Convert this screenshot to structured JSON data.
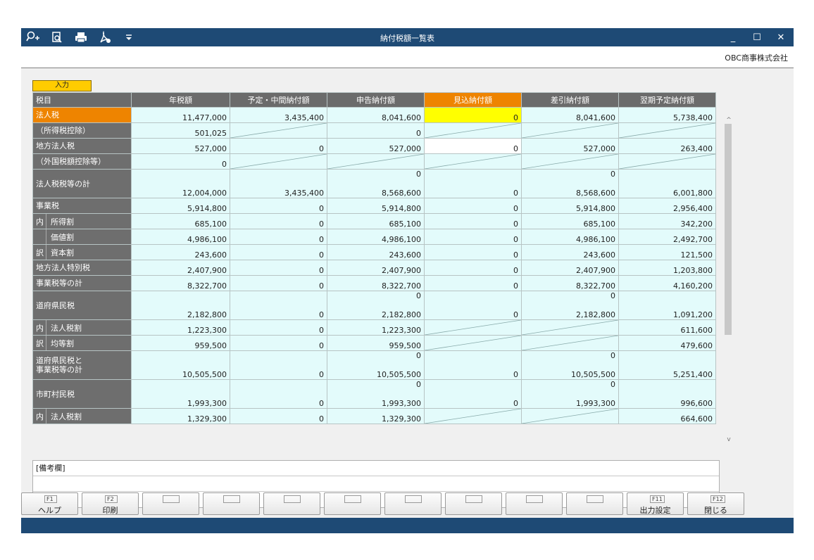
{
  "window": {
    "title": "納付税額一覧表",
    "company": "OBC商事株式会社"
  },
  "toolbar": {
    "icons": [
      "zoom-in-icon",
      "preview-icon",
      "print-icon",
      "pdf-icon",
      "dropdown-icon"
    ]
  },
  "tab": {
    "label": "入力"
  },
  "columns": [
    "税目",
    "年税額",
    "予定・中間納付額",
    "申告納付額",
    "見込納付額",
    "差引納付額",
    "翌期予定納付額"
  ],
  "rows": [
    {
      "label": "法人税",
      "type": "normal",
      "cells": [
        "11,477,000",
        "3,435,400",
        "8,041,600",
        "0",
        "8,041,600",
        "5,738,400"
      ]
    },
    {
      "label": "（所得税控除）",
      "type": "normal",
      "cells": [
        "501,025",
        "",
        "0",
        "",
        "",
        ""
      ]
    },
    {
      "label": "地方法人税",
      "type": "normal",
      "cells": [
        "527,000",
        "0",
        "527,000",
        "0",
        "527,000",
        "263,400"
      ]
    },
    {
      "label": "（外国税額控除等）",
      "type": "normal",
      "cells": [
        "0",
        "",
        "",
        "",
        "",
        ""
      ]
    },
    {
      "label": "法人税税等の計",
      "type": "tall",
      "cells": [
        "12,004,000",
        "3,435,400",
        "8,568,600",
        "0",
        "8,568,600",
        "6,001,800"
      ],
      "tops": [
        "",
        "",
        "0",
        "",
        "0",
        ""
      ]
    },
    {
      "label": "事業税",
      "type": "normal",
      "cells": [
        "5,914,800",
        "0",
        "5,914,800",
        "0",
        "5,914,800",
        "2,956,400"
      ]
    },
    {
      "label": "所得割",
      "type": "sub",
      "cells": [
        "685,100",
        "0",
        "685,100",
        "0",
        "685,100",
        "342,200"
      ]
    },
    {
      "label": "価値割",
      "type": "sub",
      "cells": [
        "4,986,100",
        "0",
        "4,986,100",
        "0",
        "4,986,100",
        "2,492,700"
      ]
    },
    {
      "label": "資本割",
      "type": "sub",
      "cells": [
        "243,600",
        "0",
        "243,600",
        "0",
        "243,600",
        "121,500"
      ]
    },
    {
      "label": "地方法人特別税",
      "type": "normal",
      "cells": [
        "2,407,900",
        "0",
        "2,407,900",
        "0",
        "2,407,900",
        "1,203,800"
      ]
    },
    {
      "label": "事業税等の計",
      "type": "normal",
      "cells": [
        "8,322,700",
        "0",
        "8,322,700",
        "0",
        "8,322,700",
        "4,160,200"
      ]
    },
    {
      "label": "道府県民税",
      "type": "tall",
      "cells": [
        "2,182,800",
        "0",
        "2,182,800",
        "0",
        "2,182,800",
        "1,091,200"
      ],
      "tops": [
        "",
        "",
        "0",
        "",
        "0",
        ""
      ]
    },
    {
      "label": "法人税割",
      "type": "sub",
      "cells": [
        "1,223,300",
        "0",
        "1,223,300",
        "",
        "",
        "611,600"
      ]
    },
    {
      "label": "均等割",
      "type": "sub",
      "cells": [
        "959,500",
        "0",
        "959,500",
        "",
        "",
        "479,600"
      ]
    },
    {
      "label": "道府県民税と\n事業税等の計",
      "type": "tall",
      "cells": [
        "10,505,500",
        "0",
        "10,505,500",
        "0",
        "10,505,500",
        "5,251,400"
      ],
      "tops": [
        "",
        "",
        "0",
        "",
        "0",
        ""
      ]
    },
    {
      "label": "市町村民税",
      "type": "tall",
      "cells": [
        "1,993,300",
        "0",
        "1,993,300",
        "0",
        "1,993,300",
        "996,600"
      ],
      "tops": [
        "",
        "",
        "0",
        "",
        "0",
        ""
      ]
    },
    {
      "label": "法人税割",
      "type": "sub",
      "cells": [
        "1,329,300",
        "0",
        "1,329,300",
        "",
        "",
        "664,600"
      ]
    }
  ],
  "sub_prefix": {
    "uchi": "内",
    "wake": "訳"
  },
  "notes": {
    "label": "[備考欄]"
  },
  "fkeys": [
    {
      "key": "F1",
      "label": "ヘルプ"
    },
    {
      "key": "F2",
      "label": "印刷"
    },
    {
      "key": "",
      "label": ""
    },
    {
      "key": "",
      "label": ""
    },
    {
      "key": "",
      "label": ""
    },
    {
      "key": "",
      "label": ""
    },
    {
      "key": "",
      "label": ""
    },
    {
      "key": "",
      "label": ""
    },
    {
      "key": "",
      "label": ""
    },
    {
      "key": "",
      "label": ""
    },
    {
      "key": "F11",
      "label": "出力設定"
    },
    {
      "key": "F12",
      "label": "閉じる"
    }
  ],
  "colors": {
    "titlebar": "#1e4a75",
    "selected": "#ee8400",
    "cell": "#e3fbfb",
    "highlight": "#ffff00"
  }
}
